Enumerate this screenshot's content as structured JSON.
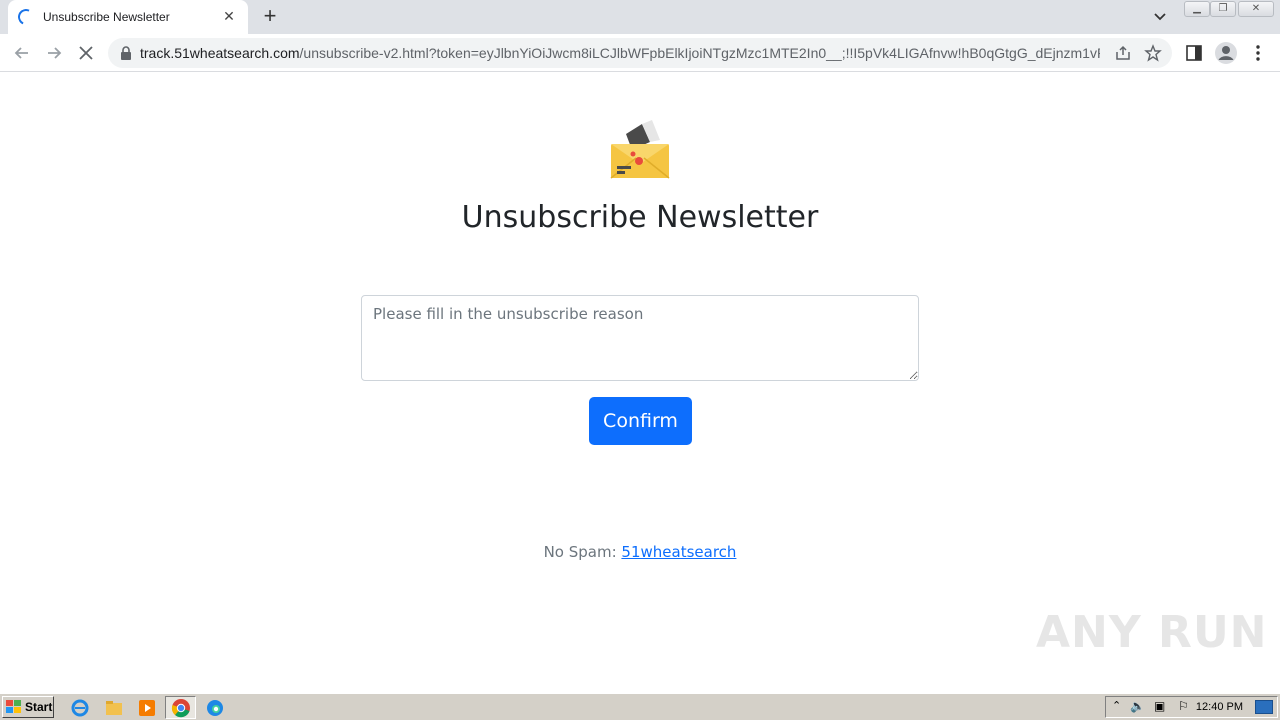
{
  "browser": {
    "tab_title": "Unsubscribe Newsletter",
    "new_tab_label": "+",
    "url_domain": "track.51wheatsearch.com",
    "url_path": "/unsubscribe-v2.html?token=eyJlbnYiOiJwcm8iLCJlbWFpbElkIjoiNTgzMzc1MTE2In0__;!!I5pVk4LIGAfnvw!hB0qGtgG_dEjnzm1vR..."
  },
  "page": {
    "heading": "Unsubscribe Newsletter",
    "reason_placeholder": "Please fill in the unsubscribe reason",
    "confirm_label": "Confirm",
    "footer_prefix": "No Spam: ",
    "footer_link": "51wheatsearch"
  },
  "watermark": "ANY RUN",
  "taskbar": {
    "start_label": "Start",
    "clock": "12:40 PM"
  },
  "colors": {
    "accent": "#0d6efd",
    "tab_strip": "#dee1e6"
  }
}
